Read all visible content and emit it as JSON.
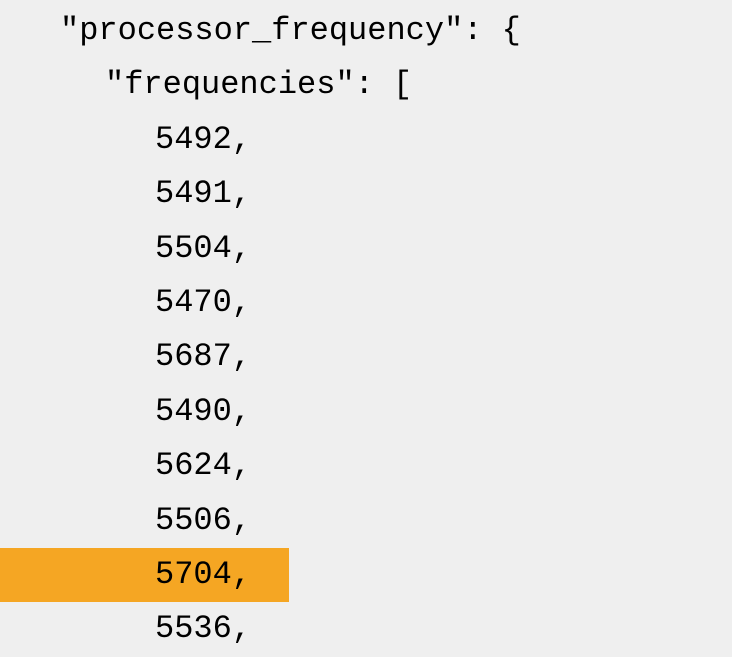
{
  "json_content": {
    "key1": "\"processor_frequency\": {",
    "key2": "\"frequencies\": [",
    "values": [
      "5492,",
      "5491,",
      "5504,",
      "5470,",
      "5687,",
      "5490,",
      "5624,",
      "5506,",
      "5704,",
      "5536,"
    ],
    "highlighted_index": 8
  }
}
